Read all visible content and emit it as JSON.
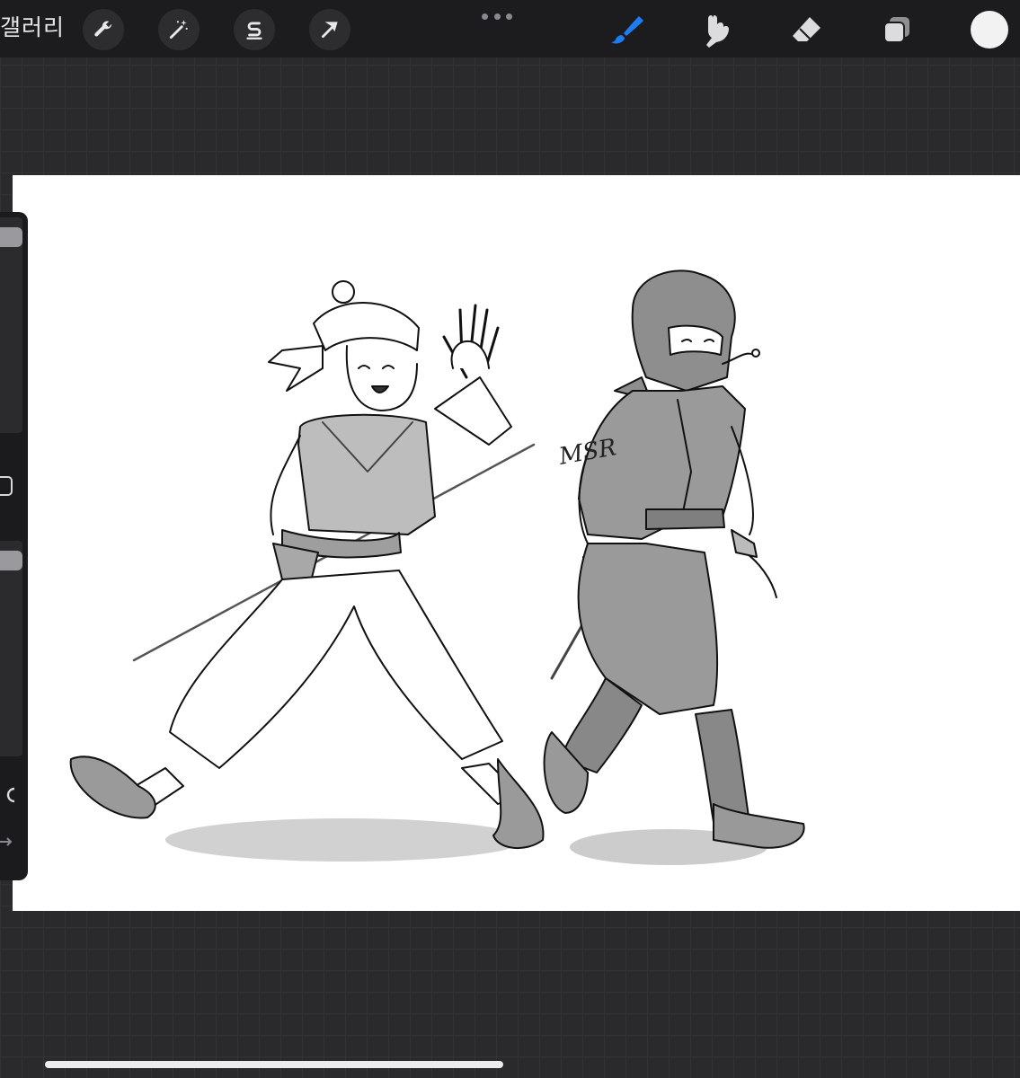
{
  "topbar": {
    "gallery_label": "갤러리",
    "left_tools": [
      {
        "icon": "wrench-icon",
        "name": "actions"
      },
      {
        "icon": "magic-wand-icon",
        "name": "adjustments"
      },
      {
        "icon": "selection-s-icon",
        "name": "selection"
      },
      {
        "icon": "arrow-cursor-icon",
        "name": "transform"
      }
    ],
    "more_icon": "ellipsis-icon",
    "right_tools": [
      {
        "icon": "brush-icon",
        "name": "brush",
        "active": true
      },
      {
        "icon": "smudge-icon",
        "name": "smudge",
        "active": false
      },
      {
        "icon": "eraser-icon",
        "name": "eraser",
        "active": false
      },
      {
        "icon": "layers-icon",
        "name": "layers",
        "active": false
      }
    ],
    "current_color": "#f2f2f2"
  },
  "sidebar": {
    "brush_size_level": 0.05,
    "opacity_level": 0.05,
    "modify_icon": "square-icon",
    "undo_icon": "undo-icon",
    "redo_icon": "redo-icon"
  },
  "artwork": {
    "signature": "MSR"
  },
  "colors": {
    "accent": "#1e7cf2",
    "toolbar_bg": "#1c1c1e",
    "workspace_bg": "#2a2a2c",
    "canvas_bg": "#ffffff"
  }
}
